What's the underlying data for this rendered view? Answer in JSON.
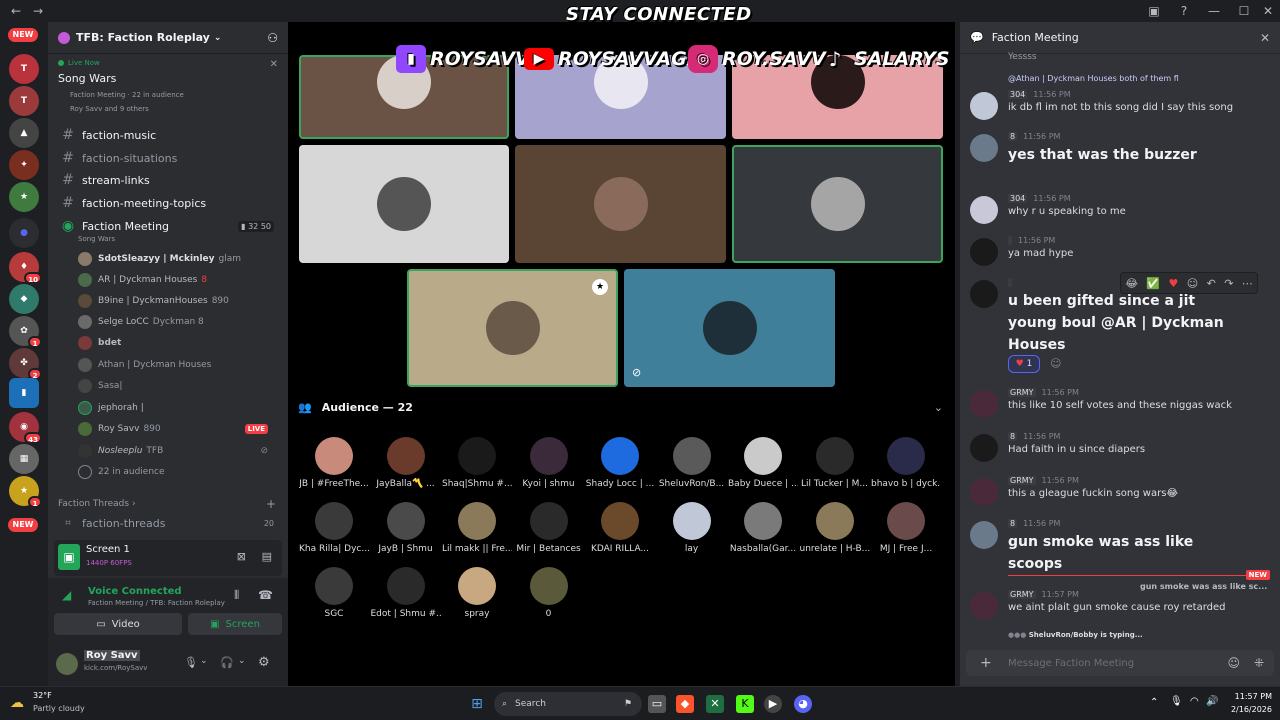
{
  "overlay": {
    "banner": "STAY CONNECTED",
    "socials": [
      {
        "icon": "twitch-icon",
        "handle": "ROYSAVV",
        "color": "#9146ff"
      },
      {
        "icon": "youtube-icon",
        "handle": "ROYSAVVAGE",
        "color": "#ff0000"
      },
      {
        "icon": "instagram-icon",
        "handle": "ROY.SAVV",
        "color": "#d62976"
      },
      {
        "icon": "tiktok-icon",
        "handle": "SALARYS",
        "color": "#000000"
      }
    ]
  },
  "rail": {
    "new_top": "NEW",
    "new_bottom": "NEW",
    "badges": [
      "10",
      "1",
      "2",
      "43",
      "1"
    ]
  },
  "sidebar": {
    "guild_name": "TFB: Faction Roleplay",
    "live_now": "Live Now",
    "live_title": "Song Wars",
    "live_channel": "Faction Meeting · 22 in audience",
    "live_people": "Roy Savv and 9 others",
    "channels": [
      "faction-music",
      "faction-situations",
      "stream-links",
      "faction-meeting-topics"
    ],
    "voice_channel": {
      "name": "Faction Meeting",
      "topic": "Song Wars",
      "count_a": "32",
      "count_b": "50"
    },
    "voice_users": [
      {
        "name": "SdotSleazyy | Mckinley",
        "tag": "glam",
        "live": false
      },
      {
        "name": "AR | Dyckman Houses",
        "tag": "8",
        "live": false
      },
      {
        "name": "B9ine | DyckmanHouses",
        "tag": "890",
        "live": false
      },
      {
        "name": "Selge LoCC",
        "tag": "Dyckman 8",
        "live": false
      },
      {
        "name": "bdet",
        "tag": "",
        "live": false
      },
      {
        "name": "Athan | Dyckman Houses",
        "tag": "",
        "live": false
      },
      {
        "name": "Sasa|",
        "tag": "",
        "live": false
      },
      {
        "name": "jephorah |",
        "tag": "",
        "live": false
      },
      {
        "name": "Roy Savv",
        "tag": "890",
        "live": true,
        "live_label": "LIVE"
      },
      {
        "name": "Nosleeplu",
        "tag": "TFB",
        "live": false
      },
      {
        "name": "22 in audience",
        "tag": "",
        "live": false
      }
    ],
    "threads_header": "Faction Threads",
    "thread": "faction-threads",
    "thread_count": "20"
  },
  "screen_panel": {
    "title": "Screen 1",
    "subtitle": "1440P 60FPS"
  },
  "voice_panel": {
    "status": "Voice Connected",
    "location": "Faction Meeting / TFB: Faction Roleplay",
    "video_label": "Video",
    "screen_label": "Screen"
  },
  "user_panel": {
    "name": "Roy Savv",
    "status": "kick.com/RoySavv"
  },
  "stage": {
    "audience_header": "Audience — 22",
    "audience": [
      "JB | #FreeThe...",
      "JayBalla〽️ ...",
      "Shaq|Shmu #...",
      "Kyoi | shmu",
      "Shady Locc | ...",
      "SheluvRon/B...",
      "Baby Duece | ...",
      "Lil Tucker | M...",
      "bhavo b | dyck...",
      "Kha Rilla| Dyc...",
      "JayB | Shmu",
      "Lil makk || Fre...",
      "Mir | Betances",
      "KDAI RILLA...",
      "lay",
      "Nasballa(Gar...",
      "unrelate | H-B...",
      "MJ | Free J...",
      "SGC",
      "Edot | Shmu #...",
      "spray",
      "0"
    ]
  },
  "chat": {
    "title": "Faction Meeting",
    "messages": [
      {
        "meta": "@Athan | Dyckman Houses both of them fl",
        "time": "",
        "text": "",
        "big": false
      },
      {
        "meta": "304",
        "time": "11:56 PM",
        "text": "ik db fl im not tb this song did I say this song",
        "big": false
      },
      {
        "meta": "8",
        "time": "11:56 PM",
        "text": "yes that was the buzzer",
        "big": true
      },
      {
        "meta": "304",
        "time": "11:56 PM",
        "text": "why r u speaking to me",
        "big": false
      },
      {
        "meta": "",
        "time": "11:56 PM",
        "text": "ya mad hype",
        "big": false
      },
      {
        "meta": "",
        "time": "",
        "text": "u been gifted since a jit young boul @AR | Dyckman Houses",
        "big": true
      },
      {
        "meta": "GRMY",
        "time": "11:56 PM",
        "text": "this like 10 self votes and these niggas wack",
        "big": false
      },
      {
        "meta": "8",
        "time": "11:56 PM",
        "text": "Had faith in u since diapers",
        "big": false
      },
      {
        "meta": "GRMY",
        "time": "11:56 PM",
        "text": "this a gleague fuckin song wars😂",
        "big": false
      },
      {
        "meta": "8",
        "time": "11:56 PM",
        "text": "gun smoke was ass like scoops",
        "big": true
      },
      {
        "meta": "GRMY",
        "time": "11:57 PM",
        "text": "we aint plait gun smoke cause roy retarded",
        "big": false
      }
    ],
    "first_line": "Yessss",
    "reaction_count": "1",
    "new_label": "NEW",
    "reply_preview": "gun smoke was ass like sc...",
    "typing": "SheluvRon/Bobby is typing...",
    "input_placeholder": "Message Faction Meeting"
  },
  "taskbar": {
    "weather_temp": "32°F",
    "weather_desc": "Partly cloudy",
    "search": "Search",
    "time": "11:57 PM",
    "date": "2/16/2026"
  }
}
